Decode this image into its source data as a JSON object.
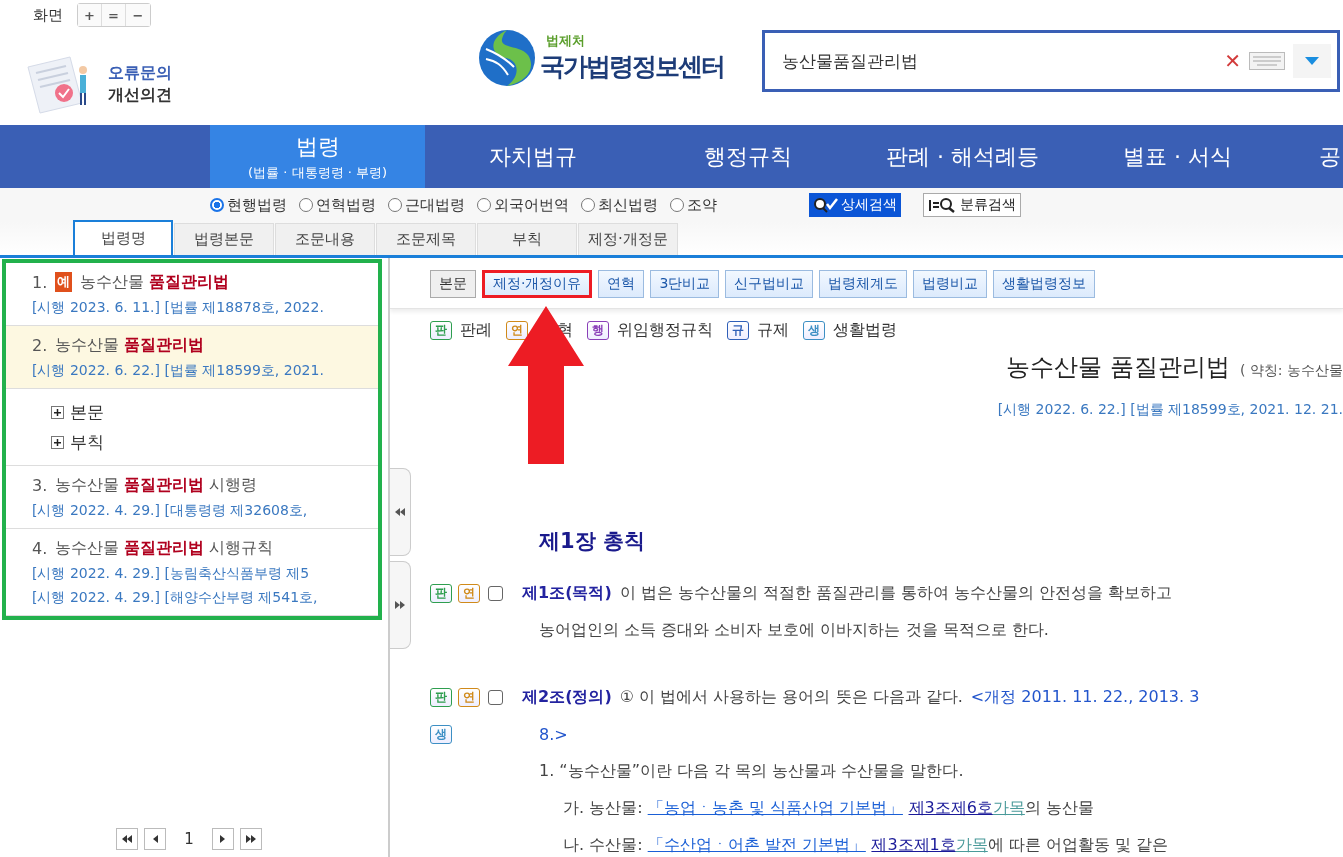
{
  "zoom_control": {
    "label": "화면",
    "buttons": [
      "+",
      "=",
      "−"
    ]
  },
  "error_report": {
    "line1": "오류문의",
    "line2": "개선의견"
  },
  "logo": {
    "agency": "법제처",
    "name": "국가법령정보센터"
  },
  "search": {
    "value": "농산물품질관리법",
    "clear": "✕"
  },
  "nav": [
    {
      "label": "법령",
      "sub": "(법률 · 대통령령 · 부령)",
      "selected": true
    },
    {
      "label": "자치법규",
      "selected": false
    },
    {
      "label": "행정규칙",
      "selected": false
    },
    {
      "label": "판례 · 해석례등",
      "selected": false
    },
    {
      "label": "별표 · 서식",
      "selected": false
    },
    {
      "label": "공",
      "selected": false
    }
  ],
  "scope_options": [
    {
      "label": "현행법령",
      "selected": true
    },
    {
      "label": "연혁법령",
      "selected": false
    },
    {
      "label": "근대법령",
      "selected": false
    },
    {
      "label": "외국어번역",
      "selected": false
    },
    {
      "label": "최신법령",
      "selected": false
    },
    {
      "label": "조약",
      "selected": false
    }
  ],
  "search_buttons": [
    {
      "label": "상세검색",
      "kind": "detail"
    },
    {
      "label": "분류검색",
      "kind": "category"
    }
  ],
  "tabs": [
    {
      "label": "법령명",
      "selected": true
    },
    {
      "label": "법령본문",
      "selected": false
    },
    {
      "label": "조문내용",
      "selected": false
    },
    {
      "label": "조문제목",
      "selected": false
    },
    {
      "label": "부칙",
      "selected": false
    },
    {
      "label": "제정·개정문",
      "selected": false
    }
  ],
  "results": [
    {
      "number": "1.",
      "badge": "예",
      "title": "농수산물 **품질관리법**",
      "selected": false,
      "lines": [
        "[시행 2023. 6. 11.] [법률 제18878호, 2022."
      ]
    },
    {
      "number": "2.",
      "title": "농수산물 **품질관리법**",
      "selected": true,
      "lines": [
        "[시행 2022. 6. 22.] [법률 제18599호, 2021."
      ],
      "children": [
        {
          "label": "본문",
          "expanded": false
        },
        {
          "label": "부칙",
          "expanded": false
        }
      ]
    },
    {
      "number": "3.",
      "title": "농수산물 **품질관리법** 시행령",
      "selected": false,
      "lines": [
        "[시행 2022. 4. 29.] [대통령령 제32608호,"
      ]
    },
    {
      "number": "4.",
      "title": "농수산물 **품질관리법** 시행규칙",
      "selected": false,
      "lines": [
        "[시행 2022. 4. 29.] [농림축산식품부령 제5",
        "[시행 2022. 4. 29.] [해양수산부령 제541호,"
      ]
    }
  ],
  "pagination": {
    "page": "1"
  },
  "content_buttons": [
    {
      "label": "본문",
      "selected": true,
      "marked": false
    },
    {
      "label": "제정·개정이유",
      "selected": false,
      "marked": true
    },
    {
      "label": "연혁",
      "selected": false,
      "marked": false
    },
    {
      "label": "3단비교",
      "selected": false,
      "marked": false
    },
    {
      "label": "신구법비교",
      "selected": false,
      "marked": false
    },
    {
      "label": "법령체계도",
      "selected": false,
      "marked": false
    },
    {
      "label": "법령비교",
      "selected": false,
      "marked": false
    },
    {
      "label": "생활법령정보",
      "selected": false,
      "marked": false
    }
  ],
  "legend": [
    {
      "badge": "판",
      "label": "판례",
      "color": "#2e9e4f"
    },
    {
      "badge": "연",
      "label": "혁",
      "color": "#d08a1a"
    },
    {
      "badge": "행",
      "label": "위임행정규칙",
      "color": "#8a3fb8"
    },
    {
      "badge": "규",
      "label": "규제",
      "color": "#2f5fb8"
    },
    {
      "badge": "생",
      "label": "생활법령",
      "color": "#3d8fc4"
    }
  ],
  "law_title": {
    "name": "농수산물 품질관리법",
    "abbreviation": "( 약칭: 농수산물"
  },
  "law_meta": "[시행 2022. 6. 22.] [법률 제18599호, 2021. 12. 21.",
  "chapter": "제1장 총칙",
  "articles": [
    {
      "badges": [
        {
          "label": "판",
          "color": "#2e9e4f"
        },
        {
          "label": "연",
          "color": "#d08a1a"
        }
      ],
      "checked": false,
      "heading": "제1조(목적)",
      "text": "이 법은 농수산물의 적절한 품질관리를 통하여 농수산물의 안전성을 확보하고",
      "lines": [
        {
          "kind": "continuation",
          "text": "농어업인의 소득 증대와 소비자 보호에 이바지하는 것을 목적으로 한다."
        }
      ]
    },
    {
      "badges": [
        {
          "label": "판",
          "color": "#2e9e4f"
        },
        {
          "label": "연",
          "color": "#d08a1a"
        }
      ],
      "checked": false,
      "heading": "제2조(정의)",
      "text": "① 이 법에서 사용하는 용어의 뜻은 다음과 같다.",
      "amendment": "<개정 2011. 11. 22., 2013. 3",
      "lines": [
        {
          "kind": "amendment",
          "text": "8.>",
          "side_badge": {
            "label": "생",
            "color": "#3d8fc4"
          }
        },
        {
          "kind": "item",
          "text": "1. “농수산물”이란 다음 각 목의 농산물과 수산물을 말한다."
        },
        {
          "kind": "subitem",
          "parts": [
            {
              "kind": "plain",
              "text": "가. 농산물: "
            },
            {
              "kind": "law-link",
              "text": "「농업ㆍ농촌 및 식품산업 기본법」"
            },
            {
              "kind": "article-link",
              "text": "제3조제6호"
            },
            {
              "kind": "item-link",
              "text": "가목"
            },
            {
              "kind": "plain",
              "text": "의 농산물"
            }
          ]
        },
        {
          "kind": "subitem",
          "parts": [
            {
              "kind": "plain",
              "text": "나. 수산물: "
            },
            {
              "kind": "law-link",
              "text": "「수산업ㆍ어촌 발전 기본법」"
            },
            {
              "kind": "article-link",
              "text": "제3조제1호"
            },
            {
              "kind": "item-link",
              "text": "가목"
            },
            {
              "kind": "plain",
              "text": "에 따른 어업활동 및 같은"
            }
          ]
        }
      ]
    }
  ]
}
